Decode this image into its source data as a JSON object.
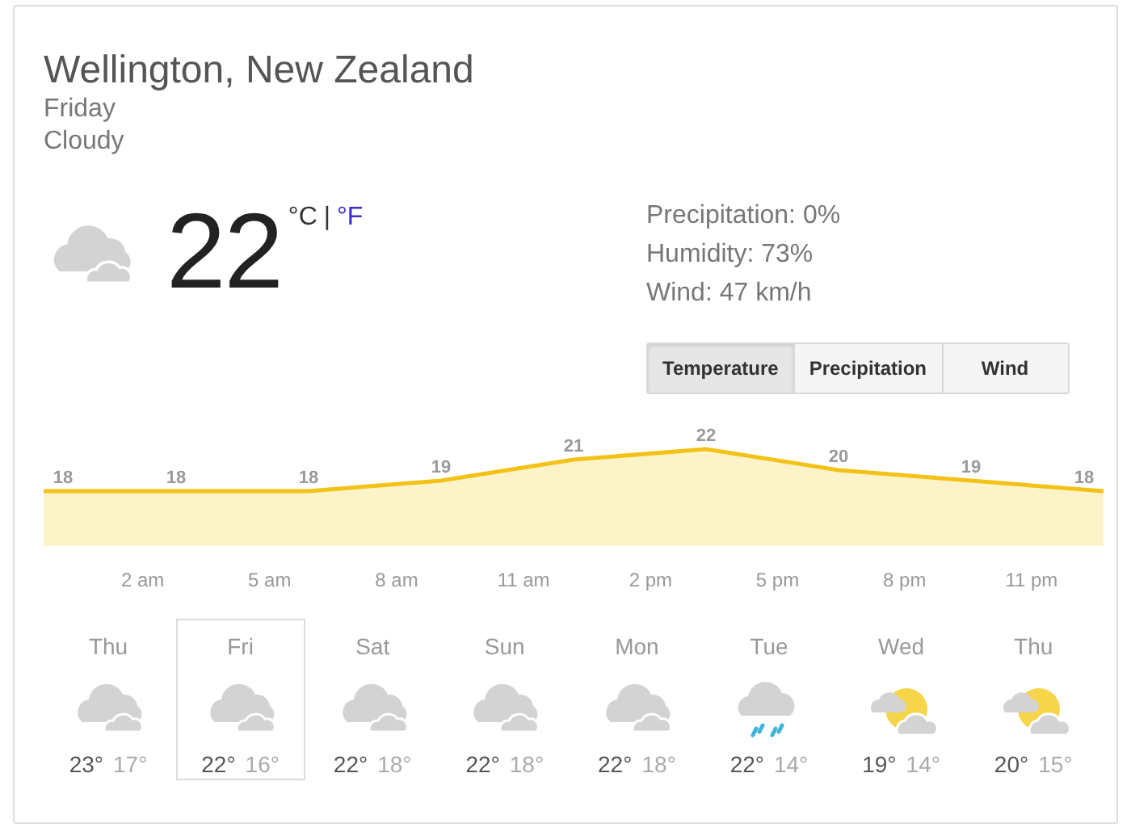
{
  "location": "Wellington, New Zealand",
  "day": "Friday",
  "condition": "Cloudy",
  "current": {
    "temperature": "22",
    "units": [
      {
        "label": "°C",
        "selected": true
      },
      {
        "label": "°F",
        "selected": false
      }
    ],
    "separator": "|"
  },
  "details": [
    "Precipitation: 0%",
    "Humidity: 73%",
    "Wind: 47 km/h"
  ],
  "tabs": [
    {
      "label": "Temperature",
      "selected": true
    },
    {
      "label": "Precipitation",
      "selected": false
    },
    {
      "label": "Wind",
      "selected": false
    }
  ],
  "chart": {
    "chart_data": {
      "type": "area",
      "categories": [
        null,
        null,
        null,
        null,
        null,
        null,
        null,
        null,
        null
      ],
      "data_labels": true,
      "series": [
        {
          "color": "#f2c217",
          "values": [
            18,
            18,
            18,
            19,
            21,
            22,
            20,
            19,
            18
          ]
        }
      ]
    },
    "time_labels": [
      "2 am",
      "5 am",
      "8 am",
      "11 am",
      "2 pm",
      "5 pm",
      "8 pm",
      "11 pm"
    ]
  },
  "forecast": [
    {
      "day": "Thu",
      "kind": "cloudy",
      "high": "23°",
      "low": "17°",
      "selected": false
    },
    {
      "day": "Fri",
      "kind": "cloudy",
      "high": "22°",
      "low": "16°",
      "selected": true
    },
    {
      "day": "Sat",
      "kind": "cloudy",
      "high": "22°",
      "low": "18°",
      "selected": false
    },
    {
      "day": "Sun",
      "kind": "cloudy",
      "high": "22°",
      "low": "18°",
      "selected": false
    },
    {
      "day": "Mon",
      "kind": "cloudy",
      "high": "22°",
      "low": "18°",
      "selected": false
    },
    {
      "day": "Tue",
      "kind": "rain",
      "high": "22°",
      "low": "14°",
      "selected": false
    },
    {
      "day": "Wed",
      "kind": "partly_cloudy",
      "high": "19°",
      "low": "14°",
      "selected": false
    },
    {
      "day": "Thu",
      "kind": "partly_cloudy",
      "high": "20°",
      "low": "15°",
      "selected": false
    }
  ]
}
